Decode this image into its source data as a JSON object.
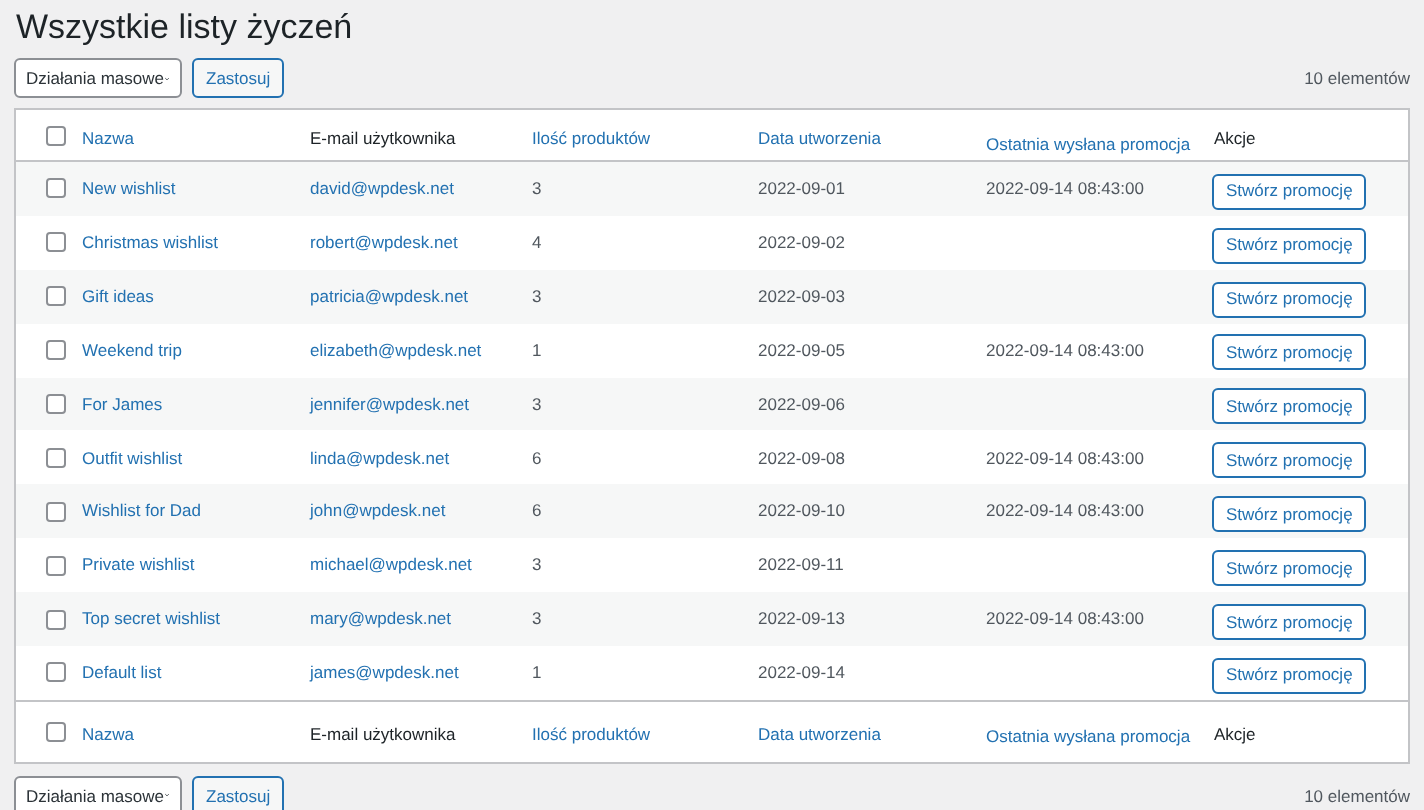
{
  "title": "Wszystkie listy życzeń",
  "top_toolbar": {
    "bulk_actions": "Działania masowe",
    "apply": "Zastosuj",
    "count": "10 elementów"
  },
  "table": {
    "select_all_checked": false,
    "header_columns": [
      {
        "label": "Nazwa",
        "sortable": true
      },
      {
        "label": "E-mail użytkownika",
        "sortable": false
      },
      {
        "label": "Ilość produktów",
        "sortable": true
      },
      {
        "label": "Data utworzenia",
        "sortable": true
      },
      {
        "label": "Ostatnia wysłana promocja",
        "sortable": true
      },
      {
        "label": "Akcje",
        "sortable": false
      }
    ],
    "rows": [
      {
        "checked": false,
        "name": "New wishlist",
        "email": "david@wpdesk.net",
        "products": "3",
        "created": "2022-09-01",
        "last_promo": "2022-09-14 08:43:00",
        "action": "Stwórz promocję"
      },
      {
        "checked": false,
        "name": "Christmas wishlist",
        "email": "robert@wpdesk.net",
        "products": "4",
        "created": "2022-09-02",
        "action": "Stwórz promocję"
      },
      {
        "checked": false,
        "name": "Gift ideas",
        "email": "patricia@wpdesk.net",
        "products": "3",
        "created": "2022-09-03",
        "action": "Stwórz promocję"
      },
      {
        "checked": false,
        "name": "Weekend trip",
        "email": "elizabeth@wpdesk.net",
        "products": "1",
        "created": "2022-09-05",
        "last_promo": "2022-09-14 08:43:00",
        "action": "Stwórz promocję"
      },
      {
        "checked": false,
        "name": "For James",
        "email": "jennifer@wpdesk.net",
        "products": "3",
        "created": "2022-09-06",
        "action": "Stwórz promocję"
      },
      {
        "checked": false,
        "name": "Outfit wishlist",
        "email": "linda@wpdesk.net",
        "products": "6",
        "created": "2022-09-08",
        "last_promo": "2022-09-14 08:43:00",
        "action": "Stwórz promocję"
      },
      {
        "checked": false,
        "name": "Wishlist for Dad",
        "email": "john@wpdesk.net",
        "products": "6",
        "created": "2022-09-10",
        "last_promo": "2022-09-14 08:43:00",
        "action": "Stwórz promocję"
      },
      {
        "checked": false,
        "name": "Private wishlist",
        "email": "michael@wpdesk.net",
        "products": "3",
        "created": "2022-09-11",
        "action": "Stwórz promocję"
      },
      {
        "checked": false,
        "name": "Top secret wishlist",
        "email": "mary@wpdesk.net",
        "products": "3",
        "created": "2022-09-13",
        "last_promo": "2022-09-14 08:43:00",
        "action": "Stwórz promocję"
      },
      {
        "checked": false,
        "name": "Default list",
        "email": "james@wpdesk.net",
        "products": "1",
        "created": "2022-09-14",
        "action": "Stwórz promocję"
      }
    ],
    "footer_select_all_checked": false,
    "footer_columns": [
      {
        "label": "Nazwa",
        "sortable": true
      },
      {
        "label": "E-mail użytkownika",
        "sortable": false
      },
      {
        "label": "Ilość produktów",
        "sortable": true
      },
      {
        "label": "Data utworzenia",
        "sortable": true
      },
      {
        "label": "Ostatnia wysłana promocja",
        "sortable": true
      },
      {
        "label": "Akcje",
        "sortable": false
      }
    ]
  },
  "bottom_toolbar": {
    "bulk_actions": "Działania masowe",
    "apply": "Zastosuj",
    "count": "10 elementów"
  }
}
